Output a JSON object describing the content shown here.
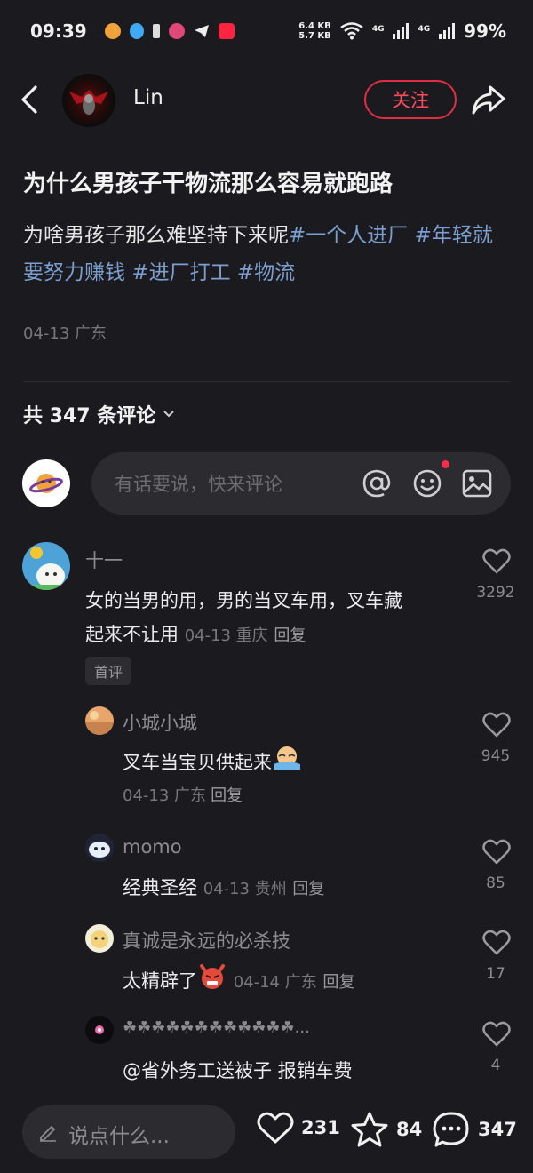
{
  "status_bar": {
    "time": "09:39",
    "net_up": "6.4 KB",
    "net_down": "5.7 KB",
    "signal1": "4G",
    "signal2": "4G",
    "battery": "99%"
  },
  "header": {
    "author_name": "Lin",
    "follow_label": "关注"
  },
  "post": {
    "title": "为什么男孩子干物流那么容易就跑路",
    "body_text": "为啥男孩子那么难坚持下来呢",
    "hashtags": [
      "#一个人进厂",
      "#年轻就要努力赚钱",
      "#进厂打工",
      "#物流"
    ],
    "meta": "04-13 广东"
  },
  "comments_section": {
    "count_label": "共 347 条评论",
    "input_placeholder": "有话要说，快来评论"
  },
  "comments": [
    {
      "name": "十一",
      "text": "女的当男的用，男的当叉车用，叉车藏起来不让用",
      "text_line1": "女的当男的用，男的当叉车用，叉车藏",
      "text_line2": "起来不让用",
      "meta": "04-13 重庆",
      "reply": "回复",
      "likes": "3292",
      "badge": "首评"
    },
    {
      "name": "小城小城",
      "text": "叉车当宝贝供起来",
      "meta": "04-13 广东",
      "reply": "回复",
      "likes": "945"
    },
    {
      "name": "momo",
      "text": "经典圣经",
      "meta": "04-13 贵州",
      "reply": "回复",
      "likes": "85"
    },
    {
      "name": "真诚是永远的必杀技",
      "text": "太精辟了",
      "meta": "04-14 广东",
      "reply": "回复",
      "likes": "17"
    },
    {
      "name": "☘☘☘☘☘☘☘☘☘☘☘☘...",
      "text": "@省外务工送被子 报销车费",
      "likes": "4"
    }
  ],
  "bottom_bar": {
    "placeholder": "说点什么...",
    "likes": "231",
    "favorites": "84",
    "comments": "347"
  },
  "colors": {
    "background": "#1b1b1f",
    "accent_red": "#e02e45",
    "hashtag_blue": "#7c9fcf"
  }
}
